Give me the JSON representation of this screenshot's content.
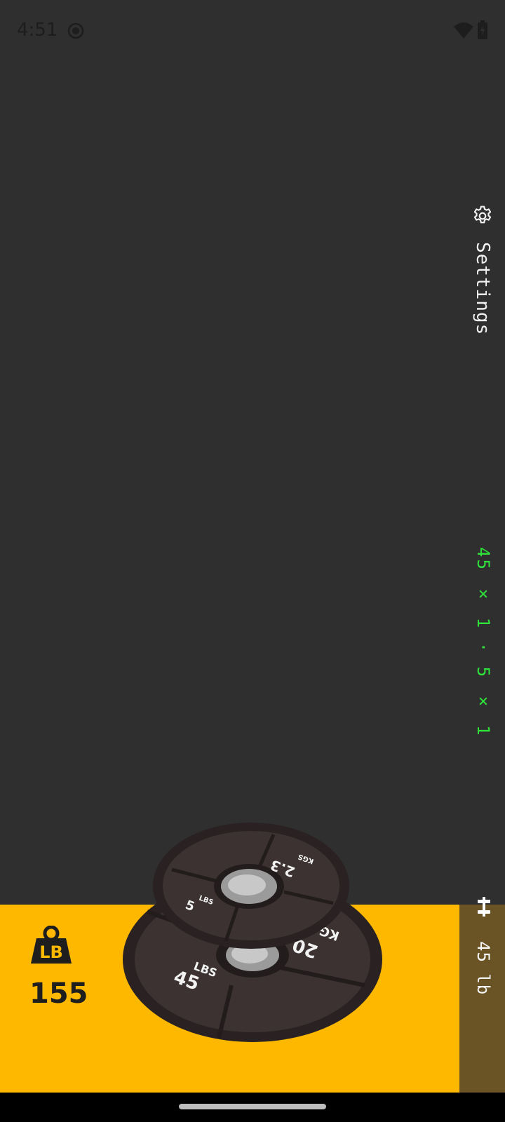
{
  "status_bar": {
    "time": "4:51",
    "icons": [
      "record-icon",
      "wifi-icon",
      "battery-charging-icon"
    ]
  },
  "settings": {
    "label": "Settings",
    "icon": "gear-icon"
  },
  "plate_summary": "45 × 1 · 5 × 1",
  "bar": {
    "icon": "barbell-icon",
    "weight_label": "45 lb",
    "panel_color": "#6a5425"
  },
  "total": {
    "icon": "weight-lb-icon",
    "unit_badge": "LB",
    "value": "155"
  },
  "plates": {
    "front": {
      "lbs_value": "5",
      "lbs_unit": "LBS",
      "kg_value": "2.3",
      "kg_unit": "KGS"
    },
    "back": {
      "lbs_value": "45",
      "lbs_unit": "LBS",
      "kg_value": "20",
      "kg_unit": "KG"
    }
  },
  "colors": {
    "background": "#2f2f30",
    "accent": "#ffb800",
    "summary_text": "#2ee23a"
  }
}
